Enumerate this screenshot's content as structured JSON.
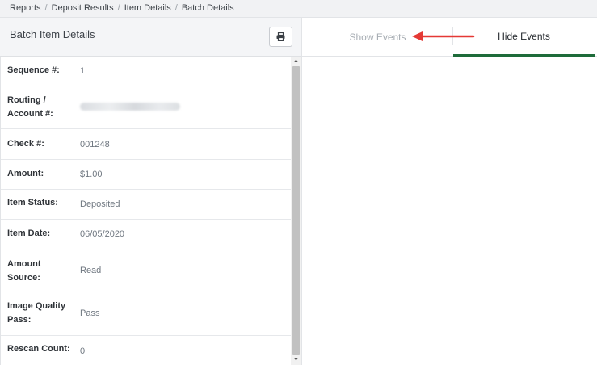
{
  "breadcrumb": {
    "items": [
      "Reports",
      "Deposit Results",
      "Item Details",
      "Batch Details"
    ],
    "separator": "/"
  },
  "panel": {
    "title": "Batch Item Details",
    "print_icon": "printer-icon"
  },
  "details": [
    {
      "label": "Sequence #:",
      "value": "1"
    },
    {
      "label": "Routing / Account #:",
      "value": ""
    },
    {
      "label": "Check #:",
      "value": "001248"
    },
    {
      "label": "Amount:",
      "value": "$1.00"
    },
    {
      "label": "Item Status:",
      "value": "Deposited"
    },
    {
      "label": "Item Date:",
      "value": "06/05/2020"
    },
    {
      "label": "Amount Source:",
      "value": "Read"
    },
    {
      "label": "Image Quality Pass:",
      "value": "Pass"
    },
    {
      "label": "Rescan Count:",
      "value": "0"
    }
  ],
  "tabs": {
    "show_events": "Show Events",
    "hide_events": "Hide Events"
  },
  "colors": {
    "active_tab_underline": "#1e6b3a",
    "annotation_arrow": "#e53935"
  }
}
